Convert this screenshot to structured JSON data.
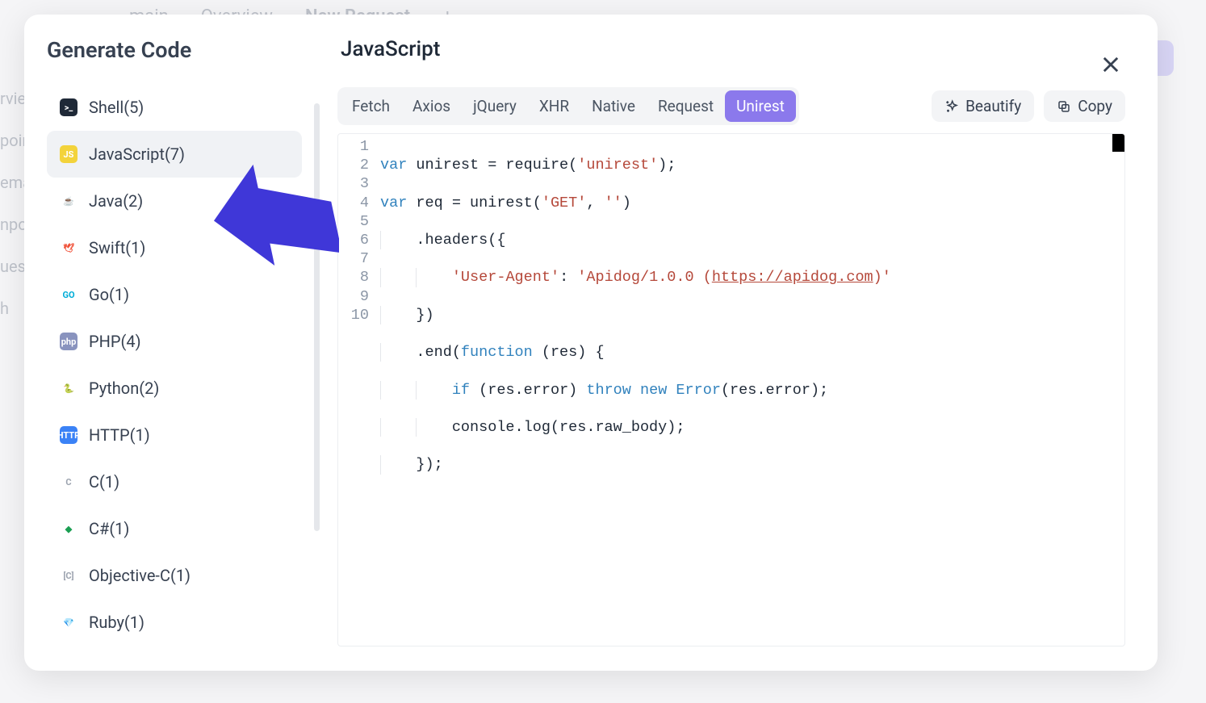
{
  "bg": {
    "main_label": "main",
    "overview_label": "Overview",
    "new_request_label": "New Request",
    "side_items": [
      "rvie",
      "poir",
      "ema",
      "npo",
      "ues",
      "h"
    ]
  },
  "modal": {
    "title": "Generate Code",
    "close_label": "Close"
  },
  "languages": [
    {
      "name": "Shell",
      "count": 5,
      "icon_bg": "#1f2937",
      "icon_txt": ">_"
    },
    {
      "name": "JavaScript",
      "count": 7,
      "icon_bg": "#f3d33b",
      "icon_txt": "JS",
      "selected": true
    },
    {
      "name": "Java",
      "count": 2,
      "icon_bg": "#ffffff",
      "icon_txt": "☕",
      "icon_fg": "#6b7280"
    },
    {
      "name": "Swift",
      "count": 1,
      "icon_bg": "#ffffff",
      "icon_txt": "🕊",
      "icon_fg": "#f05138"
    },
    {
      "name": "Go",
      "count": 1,
      "icon_bg": "#ffffff",
      "icon_txt": "GO",
      "icon_fg": "#00add8"
    },
    {
      "name": "PHP",
      "count": 4,
      "icon_bg": "#8993be",
      "icon_txt": "php"
    },
    {
      "name": "Python",
      "count": 2,
      "icon_bg": "#ffffff",
      "icon_txt": "🐍"
    },
    {
      "name": "HTTP",
      "count": 1,
      "icon_bg": "#3b82f6",
      "icon_txt": "HTTP"
    },
    {
      "name": "C",
      "count": 1,
      "icon_bg": "#ffffff",
      "icon_txt": "C",
      "icon_fg": "#9ca3af"
    },
    {
      "name": "C#",
      "count": 1,
      "icon_bg": "#ffffff",
      "icon_txt": "◆",
      "icon_fg": "#1a9e52"
    },
    {
      "name": "Objective-C",
      "count": 1,
      "icon_bg": "#ffffff",
      "icon_txt": "[C]",
      "icon_fg": "#9ca3af"
    },
    {
      "name": "Ruby",
      "count": 1,
      "icon_bg": "#ffffff",
      "icon_txt": "💎",
      "icon_fg": "#b31917"
    }
  ],
  "main_panel": {
    "title": "JavaScript",
    "tabs": [
      "Fetch",
      "Axios",
      "jQuery",
      "XHR",
      "Native",
      "Request",
      "Unirest"
    ],
    "active_tab": "Unirest",
    "beautify_label": "Beautify",
    "copy_label": "Copy"
  },
  "code": {
    "line_count": 10,
    "t1a": "var",
    "t1b": " unirest = require(",
    "t1c": "'unirest'",
    "t1d": ");",
    "t2a": "var",
    "t2b": " req = unirest(",
    "t2c": "'GET'",
    "t2d": ", ",
    "t2e": "''",
    "t2f": ")",
    "t3a": "    .headers({",
    "t4a": "        ",
    "t4b": "'User-Agent'",
    "t4c": ": ",
    "t4d": "'Apidog/1.0.0 (",
    "t4e": "https://apidog.com",
    "t4f": ")'",
    "t5a": "    })",
    "t6a": "    .end(",
    "t6b": "function",
    "t6c": " (res) {",
    "t7a": "        ",
    "t7b": "if",
    "t7c": " (res.error) ",
    "t7d": "throw",
    "t7e": " ",
    "t7f": "new",
    "t7g": " ",
    "t7h": "Error",
    "t7i": "(res.error);",
    "t8a": "        console.log(res.raw_body);",
    "t9a": "    });"
  }
}
